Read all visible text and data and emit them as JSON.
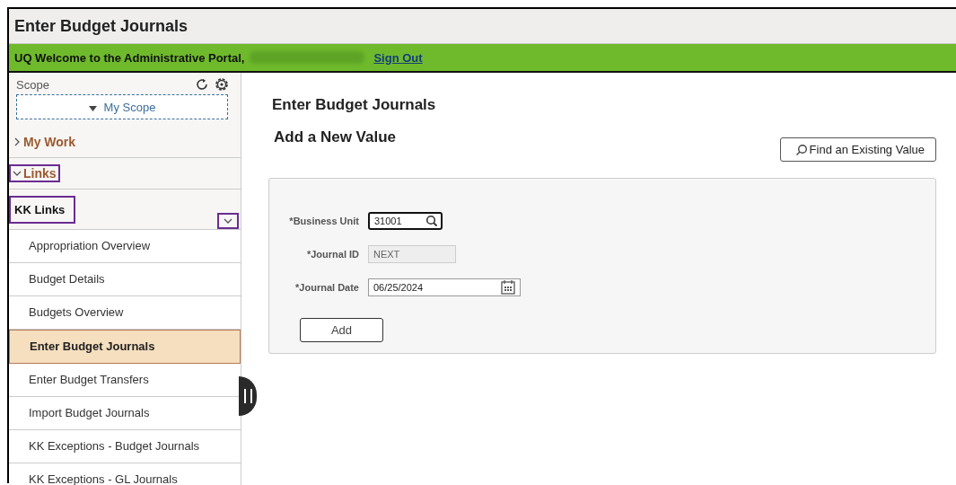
{
  "window": {
    "title": "Enter Budget Journals"
  },
  "banner": {
    "welcome": "UQ Welcome to the Administrative Portal,",
    "sign_out": "Sign Out"
  },
  "sidebar": {
    "scope_label": "Scope",
    "scope_button": "My Scope",
    "sections": [
      {
        "label": "My Work",
        "expanded": false,
        "annotated": false
      },
      {
        "label": "Links",
        "expanded": true,
        "annotated": true
      }
    ],
    "group": {
      "label": "KK Links",
      "annotated": true,
      "toggle_annotated": true
    },
    "items": [
      {
        "label": "Appropriation Overview",
        "selected": false
      },
      {
        "label": "Budget Details",
        "selected": false
      },
      {
        "label": "Budgets Overview",
        "selected": false
      },
      {
        "label": "Enter Budget Journals",
        "selected": true
      },
      {
        "label": "Enter Budget Transfers",
        "selected": false
      },
      {
        "label": "Import Budget Journals",
        "selected": false
      },
      {
        "label": "KK Exceptions - Budget Journals",
        "selected": false
      },
      {
        "label": "KK Exceptions - GL Journals",
        "selected": false
      }
    ]
  },
  "content": {
    "title": "Enter Budget Journals",
    "subtitle": "Add a New Value",
    "find_button": "Find an Existing Value",
    "fields": [
      {
        "label": "*Business Unit",
        "value": "31001",
        "kind": "lookup",
        "disabled": false
      },
      {
        "label": "*Journal ID",
        "value": "NEXT",
        "kind": "text",
        "disabled": true
      },
      {
        "label": "*Journal Date",
        "value": "06/25/2024",
        "kind": "date",
        "disabled": false
      }
    ],
    "add_button": "Add"
  }
}
